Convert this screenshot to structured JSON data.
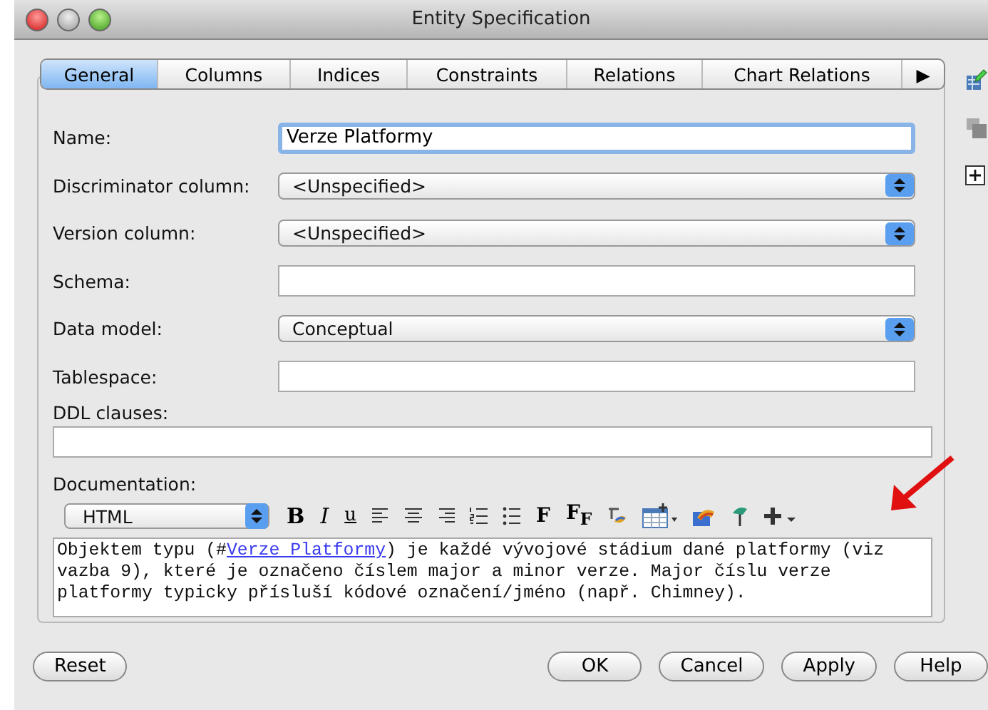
{
  "window": {
    "title": "Entity Specification"
  },
  "tabs": [
    {
      "label": "General",
      "selected": true
    },
    {
      "label": "Columns",
      "selected": false
    },
    {
      "label": "Indices",
      "selected": false
    },
    {
      "label": "Constraints",
      "selected": false
    },
    {
      "label": "Relations",
      "selected": false
    },
    {
      "label": "Chart Relations",
      "selected": false
    }
  ],
  "tab_overflow": "▶",
  "fields": [
    {
      "kind": "text",
      "label": "Name:",
      "value": "Verze Platformy",
      "focused": true
    },
    {
      "kind": "select",
      "label": "Discriminator column:",
      "value": "<Unspecified>"
    },
    {
      "kind": "select",
      "label": "Version column:",
      "value": "<Unspecified>"
    },
    {
      "kind": "text",
      "label": "Schema:",
      "focused": false
    },
    {
      "kind": "select",
      "label": "Data model:",
      "value": "Conceptual"
    },
    {
      "kind": "text",
      "label": "Tablespace:",
      "focused": false
    }
  ],
  "ddl": {
    "label": "DDL clauses:"
  },
  "documentation": {
    "label": "Documentation:",
    "format": "HTML",
    "bold": "B",
    "italic": "I",
    "underline": "u",
    "font": "F",
    "font_size": "F$_{F}$",
    "text_before": "Objektem typu (#",
    "link": "Verze Platformy",
    "text_after": ") je každé vývojové stádium dané platformy (viz vazba 9), které je označeno číslem major a minor verze. Major číslu verze platformy typicky přísluší kódové označení/jméno (např. Chimney)."
  },
  "buttons": {
    "left": [
      "Reset"
    ],
    "right": [
      "OK",
      "Cancel",
      "Apply",
      "Help"
    ]
  }
}
